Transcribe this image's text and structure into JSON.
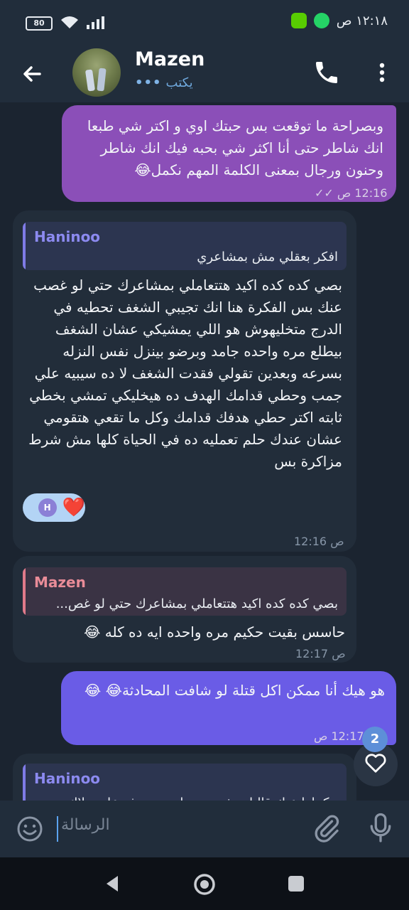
{
  "status_bar": {
    "battery": "80",
    "time": "١٢:١٨ ص"
  },
  "header": {
    "contact_name": "Mazen",
    "status": "يكتب"
  },
  "messages": [
    {
      "direction": "outgoing",
      "text": "وبصراحة ما توقعت بس حبتك اوي و اكتر شي طبعا انك شاطر حتى أنا اكثر شي بحبه فيك انك شاطر وحنون ورجال بمعنى الكلمة المهم نكمل😂",
      "time": "12:16 ص",
      "ticks": "✓✓"
    },
    {
      "direction": "incoming",
      "reply_to": {
        "name": "Haninoo",
        "text": "افكر بعقلي مش بمشاعري"
      },
      "text": "بصي كده كده اكيد هتتعاملي بمشاعرك حتي لو غصب عنك بس الفكرة هنا انك تجيبي الشغف تحطيه في الدرج متخليهوش هو اللي يمشيكي عشان الشغف بيطلع مره واحده جامد وبرضو بينزل نفس النزله بسرعه وبعدين تقولي فقدت الشغف لا ده سيبيه علي جمب وحطي قدامك الهدف ده هيخليكي تمشي بخطي ثابته اكتر حطي هدفك قدامك وكل ما تقعي هتقومي عشان عندك حلم تعمليه ده في الحياة كلها مش شرط مزاكرة بس",
      "reaction": {
        "emoji": "❤️",
        "reactor_initial": "H"
      },
      "time": "12:16 ص"
    },
    {
      "direction": "incoming",
      "reply_to": {
        "name": "Mazen",
        "text": "بصي كده كده اكيد هتتعاملي بمشاعرك حتي لو غص..."
      },
      "text": "حاسس بقيت حكيم مره واحده ايه ده كله 😂",
      "time": "12:17 ص"
    },
    {
      "direction": "outgoing",
      "text": "هو هيك أنا ممكن اكل قتلة لو شافت المحادثة😂 😂",
      "time": "12:17 ص",
      "ticks": "✓"
    },
    {
      "direction": "incoming",
      "reply_to": {
        "name": "Haninoo",
        "text": "حكيتلها عنك قالتلي شو حنين انت متعرفه علي ملاك"
      }
    }
  ],
  "reactions_fab": {
    "count": "2"
  },
  "composer": {
    "placeholder": "الرسالة"
  },
  "colors": {
    "outgoing_1": "#8b4fb8",
    "outgoing_2": "#6a5ce6",
    "incoming": "#222d3a",
    "header": "#212d3b",
    "accent": "#6fa8dc"
  }
}
